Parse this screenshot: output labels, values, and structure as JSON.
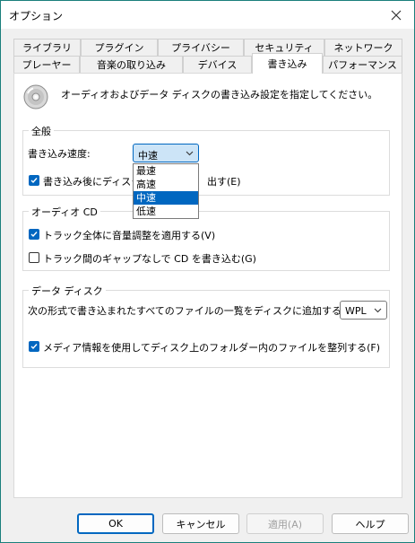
{
  "window": {
    "title": "オプション"
  },
  "tabs_row1": [
    "ライブラリ",
    "プラグイン",
    "プライバシー",
    "セキュリティ",
    "ネットワーク"
  ],
  "tabs_row2": [
    "プレーヤー",
    "音楽の取り込み",
    "デバイス",
    "書き込み",
    "パフォーマンス"
  ],
  "active_tab": "書き込み",
  "description": "オーディオおよびデータ ディスクの書き込み設定を指定してください。",
  "general": {
    "title": "全般",
    "speed_label": "書き込み速度:",
    "speed_value": "中速",
    "speed_options": [
      "最速",
      "高速",
      "中速",
      "低速"
    ],
    "eject_label_visible_start": "書き込み後にディスク",
    "eject_label_visible_end": "出す(E)",
    "eject_checked": true
  },
  "audio_cd": {
    "title": "オーディオ CD",
    "volume_label": "トラック全体に音量調整を適用する(V)",
    "volume_checked": true,
    "gapless_label": "トラック間のギャップなしで CD を書き込む(G)",
    "gapless_checked": false
  },
  "data_disc": {
    "title": "データ ディスク",
    "playlist_label": "次の形式で書き込まれたすべてのファイルの一覧をディスクに追加する:",
    "playlist_format": "WPL",
    "organize_label": "メディア情報を使用してディスク上のフォルダー内のファイルを整列する(F)",
    "organize_checked": true
  },
  "buttons": {
    "ok": "OK",
    "cancel": "キャンセル",
    "apply": "適用(A)",
    "help": "ヘルプ"
  },
  "colors": {
    "accent": "#0067c0",
    "border": "#1a7f7c"
  }
}
